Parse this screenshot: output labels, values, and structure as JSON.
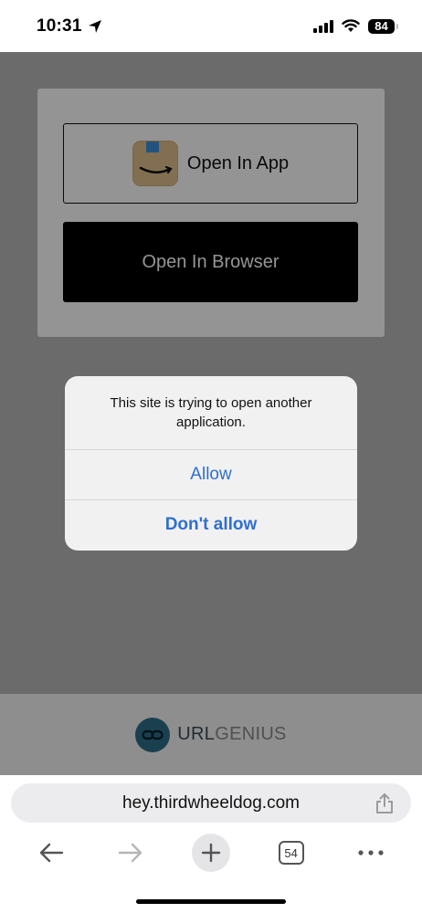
{
  "status_bar": {
    "time": "10:31",
    "battery": "84"
  },
  "page": {
    "open_app_label": "Open In App",
    "open_browser_label": "Open In Browser",
    "footer_brand_primary": "URL",
    "footer_brand_secondary": "GENIUS"
  },
  "alert": {
    "message": "This site is trying to open another application.",
    "allow_label": "Allow",
    "deny_label": "Don't allow"
  },
  "browser": {
    "address": "hey.thirdwheeldog.com",
    "tab_count": "54"
  },
  "icons": {
    "location": "location-arrow-icon",
    "signal": "cellular-signal-icon",
    "wifi": "wifi-icon",
    "battery": "battery-icon",
    "app": "amazon-app-icon",
    "link": "link-icon",
    "share": "share-icon",
    "back": "back-arrow-icon",
    "forward": "forward-arrow-icon",
    "new_tab": "plus-icon",
    "tabs": "tabs-icon",
    "more": "more-dots-icon"
  },
  "colors": {
    "alert_action": "#2f6fd0",
    "overlay": "rgba(0,0,0,0.42)",
    "brand": "#2d6e8a"
  }
}
